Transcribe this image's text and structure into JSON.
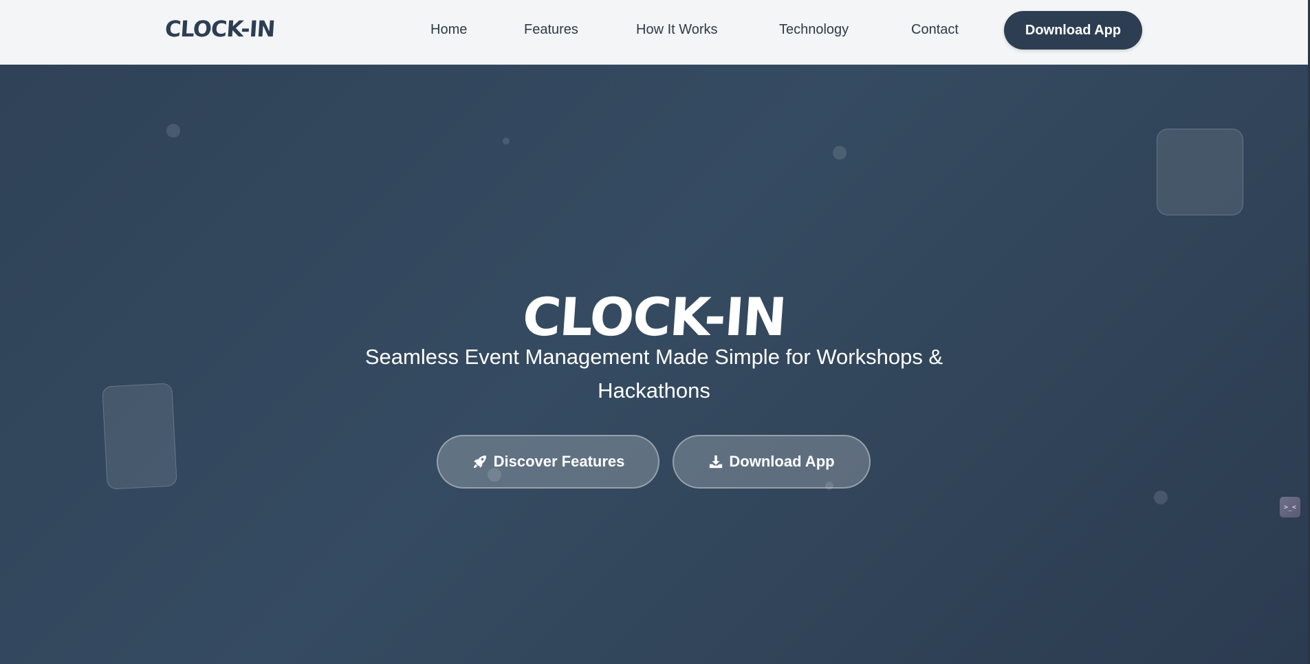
{
  "brand": {
    "logo_text": "CLOCK-IN"
  },
  "nav": {
    "links": [
      "Home",
      "Features",
      "How It Works",
      "Technology",
      "Contact"
    ],
    "cta_label": "Download App"
  },
  "hero": {
    "title": "CLOCK-IN",
    "subtitle": "Seamless Event Management Made Simple for Workshops & Hackathons",
    "buttons": [
      {
        "label": "Discover Features",
        "icon": "rocket-icon"
      },
      {
        "label": "Download App",
        "icon": "download-icon"
      }
    ]
  },
  "widget": {
    "label": ">_<",
    "icon": "terminal-icon"
  },
  "colors": {
    "navbar_bg": "#f3f5f7",
    "brand_text": "#2e3e52",
    "hero_bg": "#324559",
    "primary_button": "#2d3e52"
  }
}
